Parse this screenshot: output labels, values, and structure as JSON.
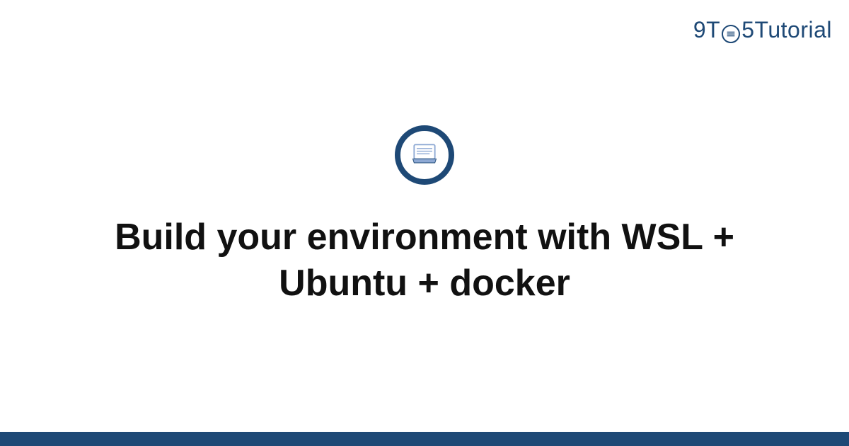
{
  "brand": {
    "prefix": "9T",
    "middle": "5",
    "suffix": "Tutorial",
    "color": "#1e4976"
  },
  "hero": {
    "title": "Build your environment with WSL + Ubuntu + docker"
  },
  "icons": {
    "laptop": "laptop-icon",
    "clock": "clock-icon"
  }
}
